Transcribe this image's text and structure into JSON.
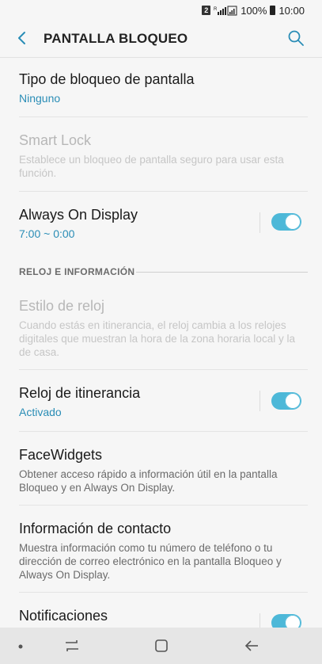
{
  "status": {
    "sim": "2",
    "battery": "100%",
    "time": "10:00"
  },
  "header": {
    "title": "PANTALLA BLOQUEO"
  },
  "items": {
    "lock_type": {
      "title": "Tipo de bloqueo de pantalla",
      "value": "Ninguno"
    },
    "smart_lock": {
      "title": "Smart Lock",
      "desc": "Establece un bloqueo de pantalla seguro para usar esta función."
    },
    "aod": {
      "title": "Always On Display",
      "value": "7:00 ~ 0:00",
      "enabled": true
    },
    "section": "RELOJ E INFORMACIÓN",
    "clock_style": {
      "title": "Estilo de reloj",
      "desc": "Cuando estás en itinerancia, el reloj cambia a los relojes digitales que muestran la hora de la zona horaria local y la de casa."
    },
    "roaming_clock": {
      "title": "Reloj de itinerancia",
      "value": "Activado",
      "enabled": true
    },
    "facewidgets": {
      "title": "FaceWidgets",
      "desc": "Obtener acceso rápido a información útil en la pantalla Bloqueo y en Always On Display."
    },
    "contact_info": {
      "title": "Información de contacto",
      "desc": "Muestra información como tu número de teléfono o tu dirección de correo electrónico en la pantalla Bloqueo y Always On Display."
    },
    "notifications": {
      "title": "Notificaciones",
      "enabled": true
    }
  },
  "colors": {
    "accent": "#2a8db6",
    "toggle_on": "#4db8d8"
  }
}
